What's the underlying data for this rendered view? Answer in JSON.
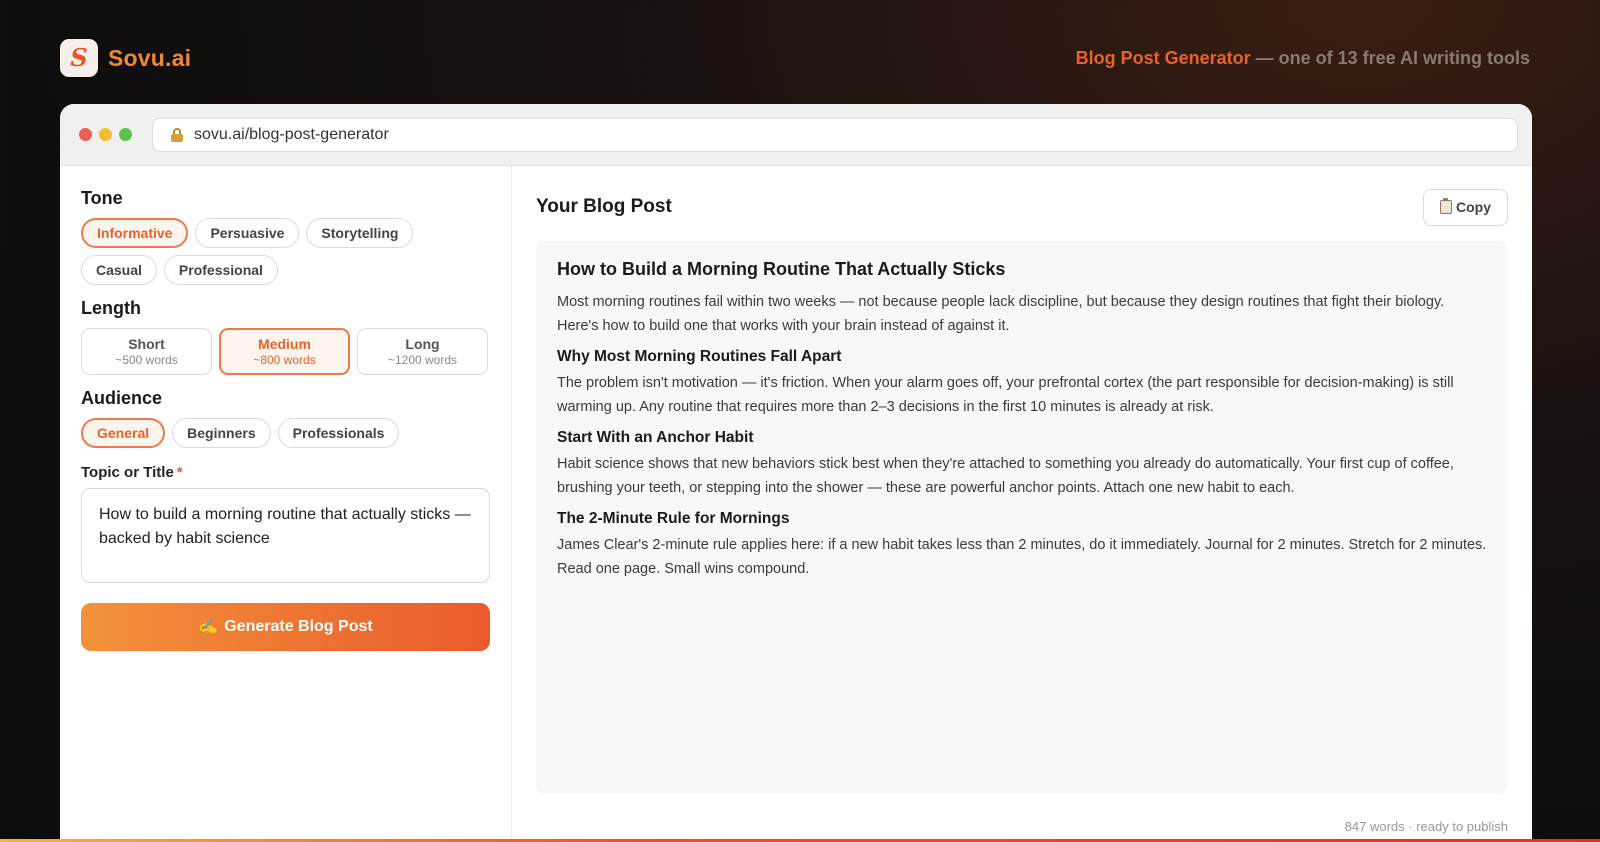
{
  "brand": {
    "name": "Sovu.ai",
    "logo_letter": "S"
  },
  "tagline": {
    "highlight": "Blog Post Generator",
    "rest": " — one of 13 free AI writing tools"
  },
  "browser": {
    "url": "sovu.ai/blog-post-generator"
  },
  "tone": {
    "title": "Tone",
    "options": [
      "Informative",
      "Persuasive",
      "Storytelling",
      "Casual",
      "Professional"
    ],
    "selected": "Informative"
  },
  "length": {
    "title": "Length",
    "options": [
      {
        "label": "Short",
        "sub": "~500 words"
      },
      {
        "label": "Medium",
        "sub": "~800 words"
      },
      {
        "label": "Long",
        "sub": "~1200 words"
      }
    ],
    "selected": "Medium"
  },
  "audience": {
    "title": "Audience",
    "options": [
      "General",
      "Beginners",
      "Professionals"
    ],
    "selected": "General"
  },
  "topic": {
    "label": "Topic or Title",
    "required_mark": "*",
    "value": "How to build a morning routine that actually sticks — backed by habit science"
  },
  "generate": {
    "label": "Generate Blog Post",
    "icon": "✍️"
  },
  "output": {
    "title": "Your Blog Post",
    "copy_label": "Copy",
    "article_title": "How to Build a Morning Routine That Actually Sticks",
    "intro": "Most morning routines fail within two weeks — not because people lack discipline, but because they design routines that fight their biology. Here's how to build one that works with your brain instead of against it.",
    "sections": [
      {
        "heading": "Why Most Morning Routines Fall Apart",
        "body": "The problem isn't motivation — it's friction. When your alarm goes off, your prefrontal cortex (the part responsible for decision-making) is still warming up. Any routine that requires more than 2–3 decisions in the first 10 minutes is already at risk."
      },
      {
        "heading": "Start With an Anchor Habit",
        "body": "Habit science shows that new behaviors stick best when they're attached to something you already do automatically. Your first cup of coffee, brushing your teeth, or stepping into the shower — these are powerful anchor points. Attach one new habit to each."
      },
      {
        "heading": "The 2-Minute Rule for Mornings",
        "body": "James Clear's 2-minute rule applies here: if a new habit takes less than 2 minutes, do it immediately. Journal for 2 minutes. Stretch for 2 minutes. Read one page. Small wins compound."
      }
    ],
    "status": "847 words · ready to publish"
  },
  "colors": {
    "accent": "#e8622c",
    "accent_light": "#f3923a"
  }
}
